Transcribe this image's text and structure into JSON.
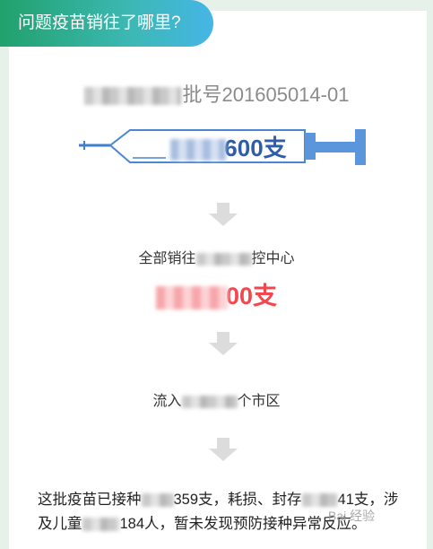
{
  "header": {
    "title": "问题疫苗销往了哪里?"
  },
  "batch": {
    "suffix": "批号201605014-01"
  },
  "dose": {
    "amount_suffix": "600支"
  },
  "distribution": {
    "to_prefix": "全部销往",
    "to_suffix": "控中心",
    "amount_suffix": "00支",
    "flow_prefix": "流入",
    "flow_suffix": "个市区"
  },
  "summary": {
    "line1_a": "这批疫苗已接种",
    "line1_b": "359支，耗损、封存",
    "line1_c": "41支，涉",
    "line2_a": "及儿童",
    "line2_b": "184人，暂未发现预防接种异常反应。"
  },
  "watermark": {
    "text": "Bai 经验"
  },
  "colors": {
    "header_start": "#21a16c",
    "header_end": "#46b6e6",
    "accent_blue": "#2d5ea8",
    "accent_red": "#f2474f"
  }
}
